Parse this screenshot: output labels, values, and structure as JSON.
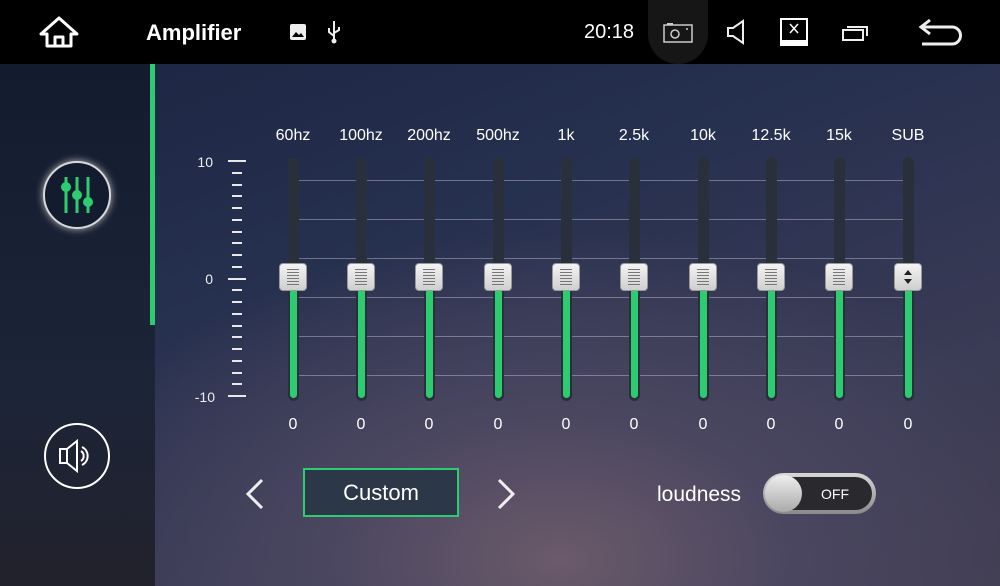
{
  "topbar": {
    "title": "Amplifier",
    "time": "20:18",
    "icons": [
      "home-icon",
      "gallery-icon",
      "usb-icon",
      "screenshot-icon",
      "volume-icon",
      "screen-off-icon",
      "recent-apps-icon",
      "back-icon"
    ]
  },
  "sidebar": {
    "items": [
      {
        "icon": "equalizer-icon",
        "active": true
      },
      {
        "icon": "speaker-icon",
        "active": false
      }
    ]
  },
  "colors": {
    "accent": "#2ecc71"
  },
  "scale": {
    "max": "10",
    "mid": "0",
    "min": "-10",
    "range": [
      -10,
      10
    ]
  },
  "bands": [
    {
      "label": "60hz",
      "value": 0
    },
    {
      "label": "100hz",
      "value": 0
    },
    {
      "label": "200hz",
      "value": 0
    },
    {
      "label": "500hz",
      "value": 0
    },
    {
      "label": "1k",
      "value": 0
    },
    {
      "label": "2.5k",
      "value": 0
    },
    {
      "label": "10k",
      "value": 0
    },
    {
      "label": "12.5k",
      "value": 0
    },
    {
      "label": "15k",
      "value": 0
    },
    {
      "label": "SUB",
      "value": 0
    }
  ],
  "preset": {
    "label": "Custom"
  },
  "loudness": {
    "label": "loudness",
    "state": "OFF"
  }
}
